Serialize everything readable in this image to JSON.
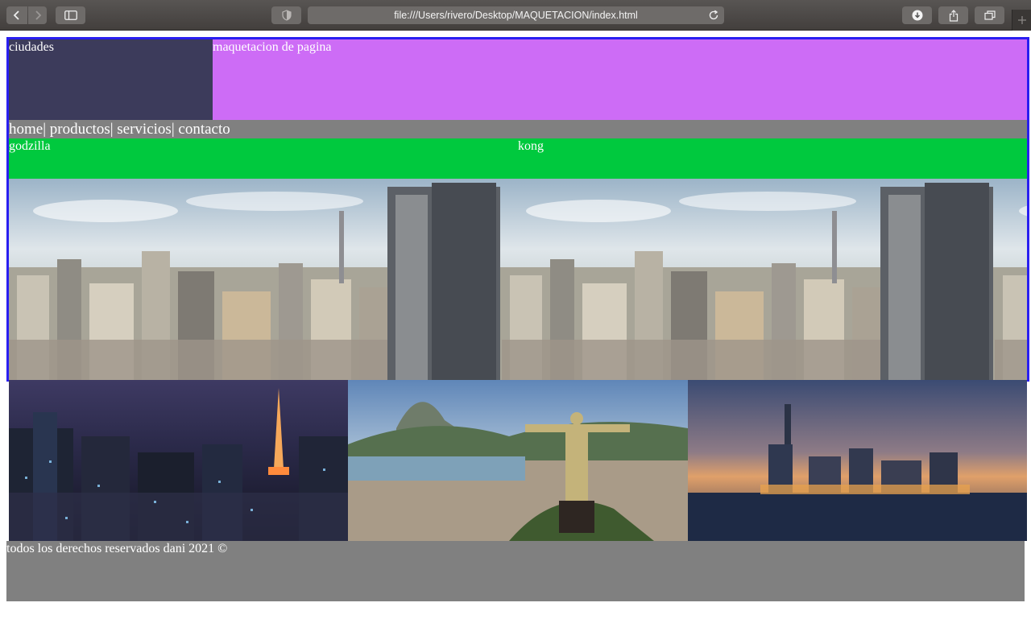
{
  "browser": {
    "url": "file:///Users/rivero/Desktop/MAQUETACION/index.html",
    "icons": [
      "back-icon",
      "forward-icon",
      "sidebar-icon",
      "shield-icon",
      "reload-icon",
      "download-icon",
      "share-icon",
      "tabs-icon",
      "new-tab-icon"
    ]
  },
  "page": {
    "logo_text": "ciudades",
    "banner_text": "maquetacion de pagina",
    "nav": {
      "items": [
        "home",
        "productos",
        "servicios",
        "contacto"
      ],
      "separator": "|"
    },
    "godzilla": "godzilla",
    "kong": "kong",
    "footer_text": "todos los derechos reservados dani 2021 ©"
  },
  "colors": {
    "wrapper_border": "#2a1ff0",
    "logo_bg": "#3c3b5b",
    "banner_bg": "#cd6cf6",
    "nav_bg": "#808080",
    "green_bg": "#00c93e",
    "footer_bg": "#808080",
    "text": "#ffffff"
  }
}
